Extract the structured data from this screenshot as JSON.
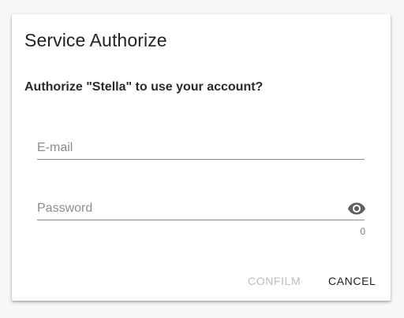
{
  "dialog": {
    "title": "Service Authorize",
    "question": "Authorize \"Stella\" to use your account?",
    "email": {
      "placeholder": "E-mail",
      "value": ""
    },
    "password": {
      "placeholder": "Password",
      "value": "",
      "counter": "0",
      "toggle_icon": "eye-icon"
    },
    "actions": {
      "confirm_label": "CONFILM",
      "cancel_label": "CANCEL"
    }
  },
  "colors": {
    "background": "#f7f7f7",
    "dialog": "#ffffff",
    "disabled_text": "#bdbdbd",
    "text": "#202020",
    "underline": "#8a8a8a"
  }
}
